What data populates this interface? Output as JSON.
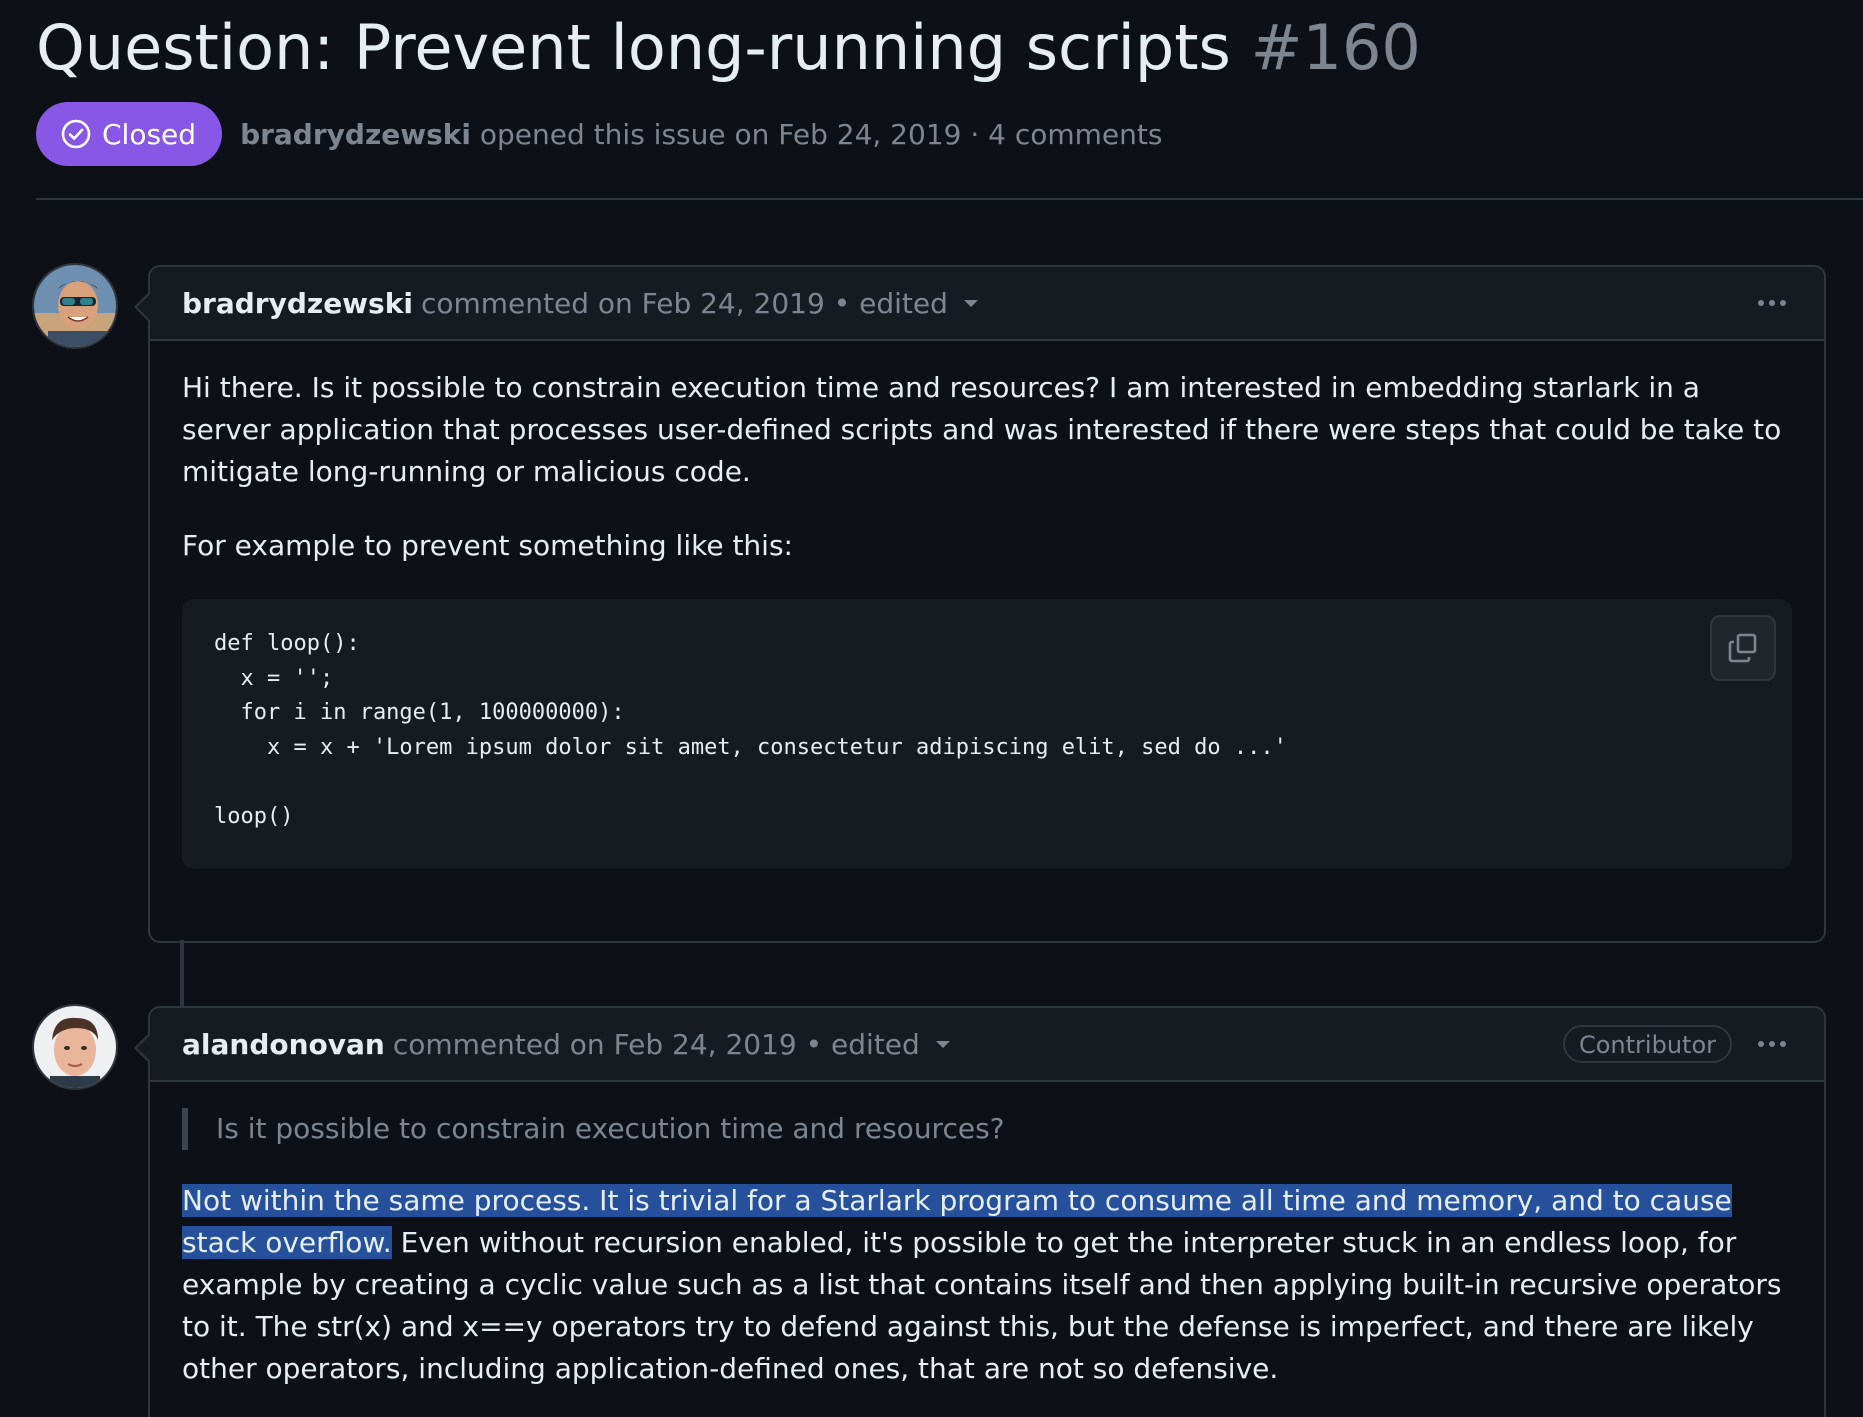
{
  "issue": {
    "title": "Question: Prevent long-running scripts",
    "number": "#160",
    "state": "Closed",
    "author": "bradrydzewski",
    "opened_text": "opened this issue on Feb 24, 2019 · 4 comments"
  },
  "comments": [
    {
      "author": "bradrydzewski",
      "meta": "commented on Feb 24, 2019 • edited",
      "paragraphs": [
        "Hi there. Is it possible to constrain execution time and resources? I am interested in embedding starlark in a server application that processes user-defined scripts and was interested if there were steps that could be take to mitigate long-running or malicious code.",
        "For example to prevent something like this:"
      ],
      "code": "def loop():\n  x = '';\n  for i in range(1, 100000000):\n    x = x + 'Lorem ipsum dolor sit amet, consectetur adipiscing elit, sed do ...'\n\nloop()"
    },
    {
      "author": "alandonovan",
      "meta": "commented on Feb 24, 2019 • edited",
      "role": "Contributor",
      "quote": "Is it possible to constrain execution time and resources?",
      "highlighted": "Not within the same process. It is trivial for a Starlark program to consume all time and memory, and to cause stack overflow.",
      "rest": " Even without recursion enabled, it's possible to get the interpreter stuck in an endless loop, for example by creating a cyclic value such as a list that contains itself and then applying built-in recursive operators to it. The str(x) and x==y operators try to defend against this, but the defense is imperfect, and there are likely other operators, including application-defined ones, that are not so defensive."
    }
  ],
  "icons": {
    "state": "check-circle-icon",
    "copy": "copy-icon",
    "more": "kebab-horizontal-icon",
    "dropdown": "triangle-down-icon"
  },
  "colors": {
    "background": "#0d1117",
    "closed_badge": "#8957e5",
    "selection": "#264f9c",
    "border": "#30363d",
    "muted_text": "#7d8590"
  }
}
